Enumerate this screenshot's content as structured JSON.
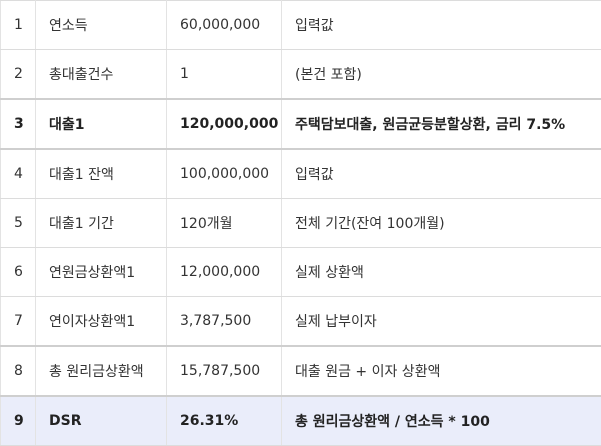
{
  "rows": [
    {
      "num": "1",
      "item": "연소득",
      "value": "60,000,000",
      "note": "입력값"
    },
    {
      "num": "2",
      "item": "총대출건수",
      "value": "1",
      "note": "(본건 포함)"
    },
    {
      "num": "3",
      "item": "대출1",
      "value": "120,000,000",
      "note": "주택담보대출, 원금균등분할상환, 금리 7.5%"
    },
    {
      "num": "4",
      "item": "대출1 잔액",
      "value": "100,000,000",
      "note": "입력값"
    },
    {
      "num": "5",
      "item": "대출1 기간",
      "value": "120개월",
      "note": "전체 기간(잔여 100개월)"
    },
    {
      "num": "6",
      "item": "연원금상환액1",
      "value": "12,000,000",
      "note": "실제 상환액"
    },
    {
      "num": "7",
      "item": "연이자상환액1",
      "value": "3,787,500",
      "note": "실제 납부이자"
    },
    {
      "num": "8",
      "item": "총 원리금상환액",
      "value": "15,787,500",
      "note": "대출 원금 + 이자 상환액"
    },
    {
      "num": "9",
      "item": "DSR",
      "value": "26.31%",
      "note": "총 원리금상환액 / 연소득 * 100"
    }
  ],
  "colors": {
    "highlight_row_bg": "#eaedfa",
    "border": "#dcdcdc"
  }
}
